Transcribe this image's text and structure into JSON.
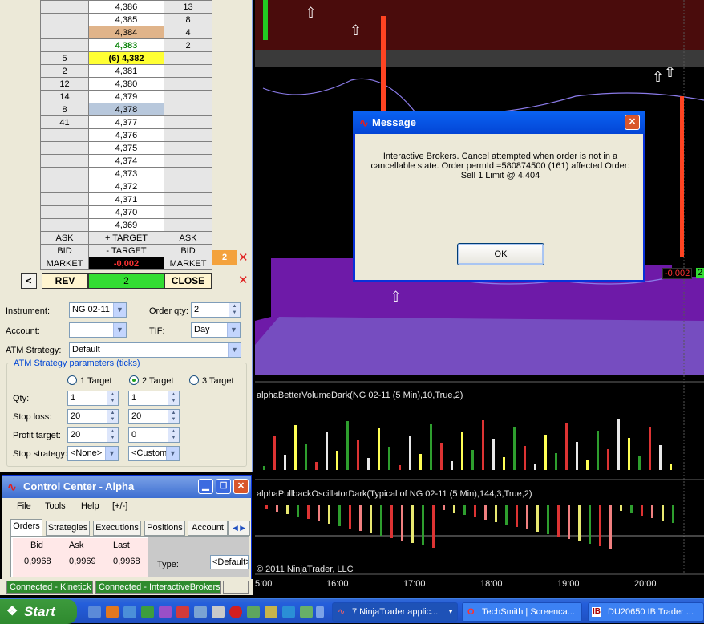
{
  "ladder": {
    "rows": [
      {
        "left": "",
        "price": "4,386",
        "right": "13"
      },
      {
        "left": "",
        "price": "4,385",
        "right": "8"
      },
      {
        "left": "",
        "price": "4,384",
        "right": "4"
      },
      {
        "left": "",
        "price": "4,383",
        "right": "2"
      },
      {
        "left": "5",
        "price": "(6) 4,382",
        "right": ""
      },
      {
        "left": "2",
        "price": "4,381",
        "right": ""
      },
      {
        "left": "12",
        "price": "4,380",
        "right": ""
      },
      {
        "left": "14",
        "price": "4,379",
        "right": ""
      },
      {
        "left": "8",
        "price": "4,378",
        "right": ""
      },
      {
        "left": "41",
        "price": "4,377",
        "right": ""
      },
      {
        "left": "",
        "price": "4,376",
        "right": ""
      },
      {
        "left": "",
        "price": "4,375",
        "right": ""
      },
      {
        "left": "",
        "price": "4,374",
        "right": ""
      },
      {
        "left": "",
        "price": "4,373",
        "right": ""
      },
      {
        "left": "",
        "price": "4,372",
        "right": ""
      },
      {
        "left": "",
        "price": "4,371",
        "right": ""
      },
      {
        "left": "",
        "price": "4,370",
        "right": ""
      },
      {
        "left": "",
        "price": "4,369",
        "right": ""
      }
    ],
    "ask_left": "ASK",
    "ask_mid": "+ TARGET",
    "ask_right": "ASK",
    "bid_left": "BID",
    "bid_mid": "- TARGET",
    "bid_right": "BID",
    "market_left": "MARKET",
    "market_mid": "-0,002",
    "market_right": "MARKET",
    "order_qty_badge": "2"
  },
  "controls": {
    "back_label": "<",
    "rev_label": "REV",
    "position_qty": "2",
    "close_label": "CLOSE",
    "instrument_label": "Instrument:",
    "instrument_value": "NG 02-11",
    "orderqty_label": "Order qty:",
    "orderqty_value": "2",
    "account_label": "Account:",
    "account_value": "",
    "tif_label": "TIF:",
    "tif_value": "Day",
    "atm_label": "ATM Strategy:",
    "atm_value": "Default",
    "atm_params_legend": "ATM Strategy parameters (ticks)",
    "target1": "1 Target",
    "target2": "2 Target",
    "target3": "3 Target",
    "qty_label": "Qty:",
    "qty1": "1",
    "qty2": "1",
    "stoploss_label": "Stop loss:",
    "sl1": "20",
    "sl2": "20",
    "profit_label": "Profit target:",
    "pt1": "20",
    "pt2": "0",
    "stopstrat_label": "Stop strategy:",
    "ss1": "<None>",
    "ss2": "<Custom"
  },
  "control_center": {
    "title": "Control Center - Alpha",
    "menu": [
      "File",
      "Tools",
      "Help",
      "[+/-]"
    ],
    "tabs": [
      "Orders",
      "Strategies",
      "Executions",
      "Positions",
      "Account"
    ],
    "bid_label": "Bid",
    "ask_label": "Ask",
    "last_label": "Last",
    "bid": "0,9968",
    "ask": "0,9969",
    "last": "0,9968",
    "type_label": "Type:",
    "type_value": "<Default>"
  },
  "status": {
    "kinetick": "Connected - Kinetick",
    "ib": "Connected - InteractiveBrokers"
  },
  "chart": {
    "panel2_title": "alphaBetterVolumeDark(NG 02-11 (5 Min),10,True,2)",
    "panel3_title": "alphaPullbackOscillatorDark(Typical of NG 02-11 (5 Min),144,3,True,2)",
    "copyright": "© 2011 NinjaTrader, LLC",
    "times": [
      "5:00",
      "16:00",
      "17:00",
      "18:00",
      "19:00",
      "20:00"
    ],
    "price_tag": "-0,002",
    "qty_tag": "2"
  },
  "dialog": {
    "title": "Message",
    "message": "Interactive Brokers. Cancel attempted when order is not in a cancellable state.  Order permId =580874500 (161) affected Order: Sell 1 Limit @ 4,404",
    "ok_label": "OK"
  },
  "taskbar": {
    "start_label": "Start",
    "tasks": [
      "7 NinjaTrader applic...",
      "TechSmith | Screenca...",
      "DU20650 IB Trader ..."
    ]
  },
  "colors": {
    "ask_highlight": "#e0b48a",
    "last_highlight": "#ffff33",
    "bid_highlight": "#b8c8dc",
    "position_green": "#33dd33",
    "market_red": "#ff3333",
    "chart_purple": "#7a1fb0"
  }
}
